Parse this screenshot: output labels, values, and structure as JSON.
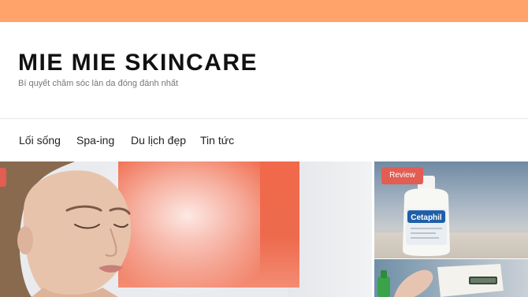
{
  "site": {
    "title": "MIE MIE SKINCARE",
    "tagline": "Bí quyết chăm sóc làn da đóng đánh nhất"
  },
  "nav": {
    "items": [
      {
        "label": "Lối sống"
      },
      {
        "label": "Spa-ing"
      },
      {
        "label": "Du lịch đẹp"
      },
      {
        "label": "Tin tức"
      }
    ]
  },
  "featured": {
    "side_post_badge": "Review",
    "product_label": "Cetaphil"
  },
  "colors": {
    "top_bar": "#ffa36b",
    "badge": "#e25d52"
  }
}
